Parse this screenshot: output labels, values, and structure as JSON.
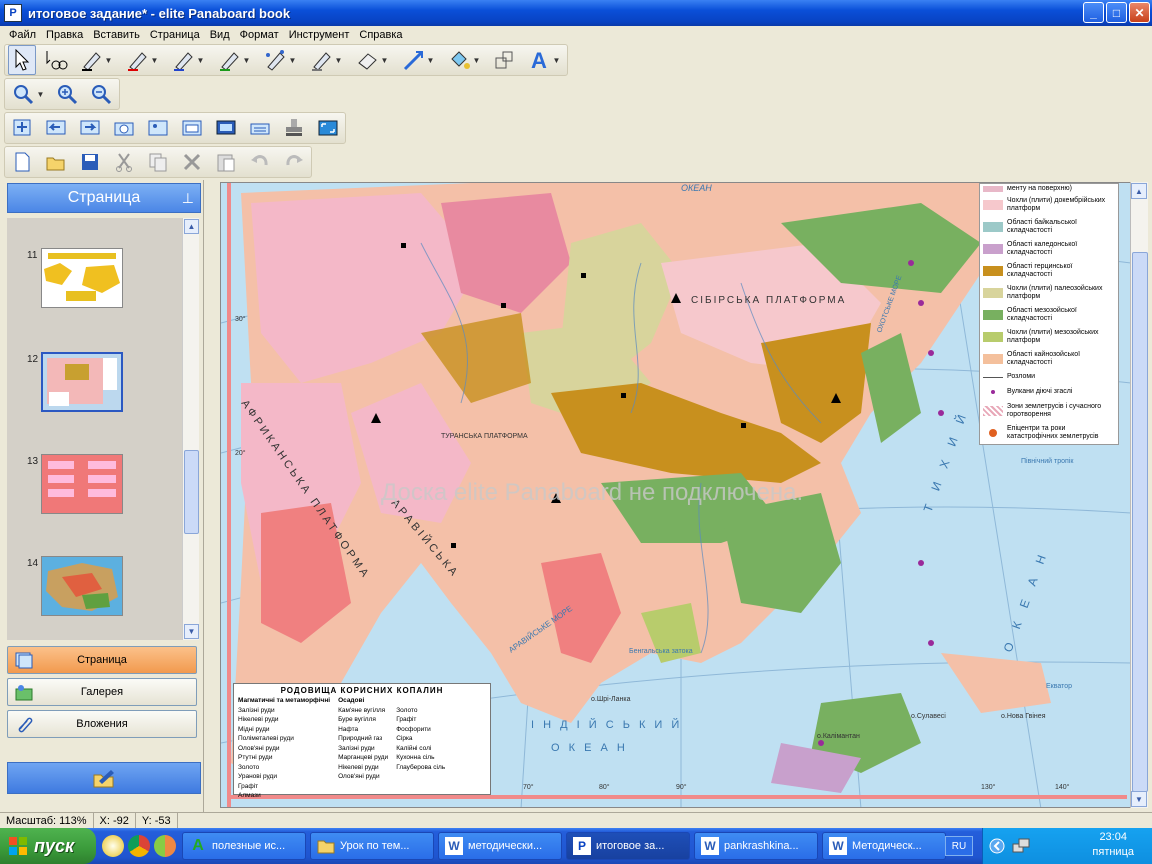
{
  "window": {
    "title": "итоговое задание* - elite Panaboard book",
    "controls": {
      "minimize": "_",
      "maximize": "□",
      "close": "✕"
    }
  },
  "menu": [
    "Файл",
    "Правка",
    "Вставить",
    "Страница",
    "Вид",
    "Формат",
    "Инструмент",
    "Справка"
  ],
  "left_panel": {
    "header": "Страница",
    "thumbnails": [
      {
        "number": "11"
      },
      {
        "number": "12"
      },
      {
        "number": "13"
      },
      {
        "number": "14"
      }
    ],
    "buttons": [
      {
        "label": "Страница"
      },
      {
        "label": "Галерея"
      },
      {
        "label": "Вложения"
      }
    ]
  },
  "canvas": {
    "watermark": "Доска elite Panaboard не подключена.",
    "map_labels": {
      "ocean_north": "ОКЕАН",
      "siberian_platform": "СІБІРСЬКА ПЛАТФОРМА",
      "african_platform": "АФРИКАНСЬКА ПЛАТФОРМА",
      "arabian": "АРАВІЙСЬКА",
      "indian_ocean": "І Н Д І Й С Ь К И Й",
      "indian_ocean2": "О К Е А Н",
      "pacific": "Т И Х И Й",
      "pacific2": "О К Е А Н",
      "arabian_sea": "АРАВІЙСЬКЕ МОРЕ",
      "bengal": "Бенгальська затока",
      "sri_lanka": "о.Шрі-Ланка",
      "kalimantan": "о.Калімантан",
      "new_guinea": "о.Нова Гвінея",
      "sulawesi": "о.Сулавесі",
      "equator": "Екватор",
      "tropic": "Північний тропік",
      "turan": "ТУРАНСЬКА ПЛАТФОРМА",
      "lat30": "30°",
      "lat20": "20°",
      "lon70": "70°",
      "lon80": "80°",
      "lon90": "90°",
      "lon130": "130°",
      "lon140": "140°",
      "okhotsk": "ОХОТСЬКЕ МОРЕ"
    },
    "legend": [
      {
        "label": "менту на поверхню)",
        "color": "#e8b8c8"
      },
      {
        "label": "Чохли (плити) докембрійських платформ",
        "color": "#f6c8cc"
      },
      {
        "label": "Області байкальської складчастості",
        "color": "#9cc9c8"
      },
      {
        "label": "Області каледонської складчастості",
        "color": "#c9a0cc"
      },
      {
        "label": "Області герцинської складчастості",
        "color": "#c8901e"
      },
      {
        "label": "Чохли (плити) палеозойських платформ",
        "color": "#d8d49c"
      },
      {
        "label": "Області мезозойської складчастості",
        "color": "#78b060"
      },
      {
        "label": "Чохли (плити) мезозойських платформ",
        "color": "#b8cc6c"
      },
      {
        "label": "Області кайнозойської складчастості",
        "color": "#f4c09c"
      },
      {
        "label": "Розломи",
        "color": "#555555"
      },
      {
        "label": "Вулкани діючі згаслі",
        "color": "#9a2a9a"
      },
      {
        "label": "Зони землетрусів і сучасного горотворення",
        "color": "#e8a8b8"
      },
      {
        "label": "Епіцентри та роки катастрофічних землетрусів",
        "color": "#e06020"
      }
    ],
    "minerals": {
      "title": "РОДОВИЩА КОРИСНИХ КОПАЛИН",
      "col1_header": "Магматичні та метаморфічні",
      "col2_header": "Осадові",
      "col1": [
        "Залізні руди",
        "Нікелеві руди",
        "Мідні руди",
        "Поліметалеві руди",
        "Олов'яні руди",
        "Ртутні руди",
        "Золото",
        "Уранові руди",
        "Графіт",
        "Алмази"
      ],
      "col2": [
        "Кам'яне вугілля",
        "Буре вугілля",
        "Нафта",
        "Природний газ",
        "Залізні руди",
        "Марганцеві руди",
        "Нікелеві руди",
        "Олов'яні руди"
      ],
      "col3": [
        "Золото",
        "Графіт",
        "Фосфорити",
        "Сірка",
        "Калійні солі",
        "Кухонна сіль",
        "Глауберова сіль"
      ]
    }
  },
  "status": {
    "scale": "Масштаб: 113%",
    "x": "X: -92",
    "y": "Y: -53"
  },
  "taskbar": {
    "start": "пуск",
    "tasks": [
      {
        "label": "полезные ис...",
        "icon": "A"
      },
      {
        "label": "Урок по тем...",
        "icon": "folder"
      },
      {
        "label": "методически...",
        "icon": "W"
      },
      {
        "label": "итоговое за...",
        "icon": "pb"
      },
      {
        "label": "pankrashkina...",
        "icon": "W"
      },
      {
        "label": "Методическ...",
        "icon": "W"
      }
    ],
    "lang": "RU",
    "time": "23:04",
    "day": "пятница"
  },
  "colors": {
    "accent": "#0842c2",
    "panel_header": "#4b86e6",
    "active_button": "#f29a4e",
    "taskbar": "#245edb",
    "start": "#3a9a3a"
  }
}
